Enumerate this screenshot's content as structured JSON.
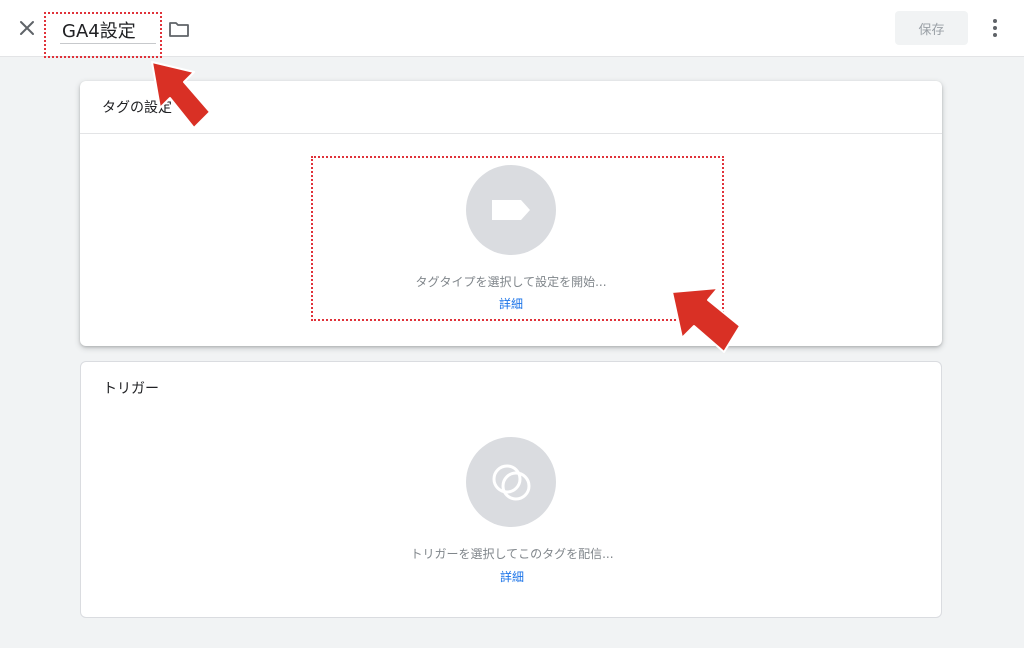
{
  "header": {
    "title_value": "GA4設定",
    "save_label": "保存"
  },
  "tag_card": {
    "heading": "タグの設定",
    "hint": "タグタイプを選択して設定を開始...",
    "detail_link": "詳細"
  },
  "trigger_card": {
    "heading": "トリガー",
    "hint": "トリガーを選択してこのタグを配信...",
    "detail_link": "詳細"
  },
  "colors": {
    "accent_link": "#1a73e8",
    "annotation_red": "#d93025",
    "dotted_highlight": "#e0323a",
    "icon_circle": "#dadce0"
  },
  "icons": {
    "close": "close-icon",
    "folder": "folder-icon",
    "more": "more-vert-icon",
    "tag": "tag-icon",
    "trigger": "trigger-icon",
    "arrow": "red-arrow-icon"
  }
}
